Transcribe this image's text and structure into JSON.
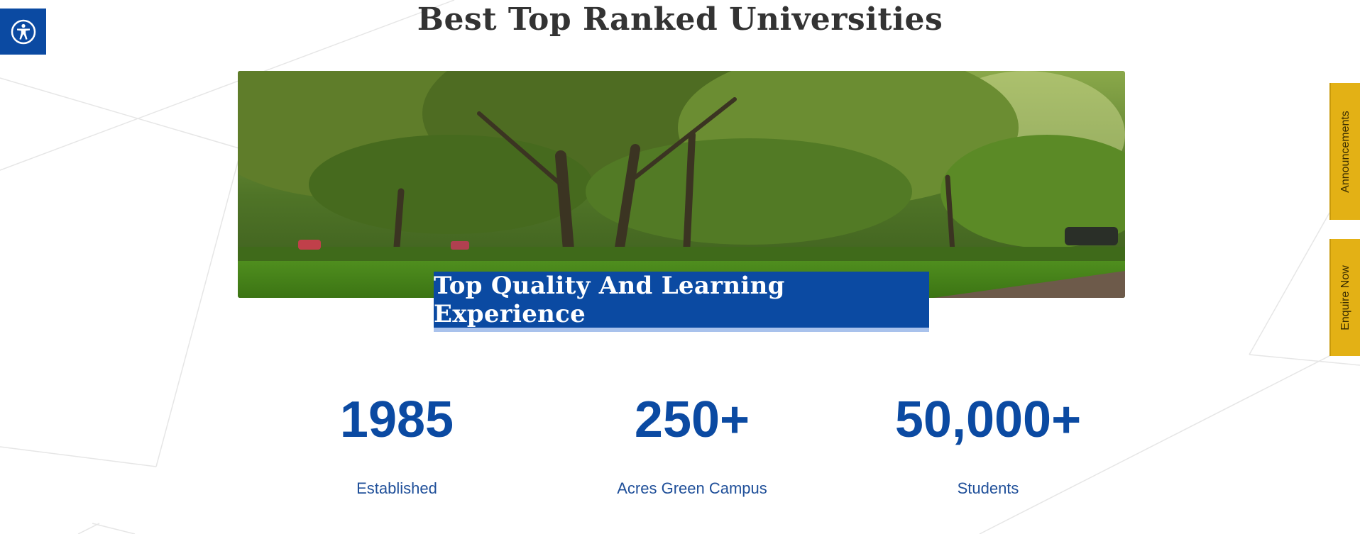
{
  "accessibility": {
    "icon": "accessibility-icon",
    "color": "#0b4aa2"
  },
  "section": {
    "title": "Best Top Ranked Universities"
  },
  "hero": {
    "image": "campus-trees-photo",
    "caption": "Top Quality And Learning Experience"
  },
  "stats": [
    {
      "value": "1985",
      "label": "Established"
    },
    {
      "value": "250+",
      "label": "Acres Green Campus"
    },
    {
      "value": "50,000+",
      "label": "Students"
    }
  ],
  "side_tabs": {
    "announcements": "Announcements",
    "enquire": "Enquire Now"
  },
  "colors": {
    "primary_blue": "#0b4aa2",
    "accent_yellow": "#e3b115",
    "caption_underline": "#a9c2ec"
  }
}
